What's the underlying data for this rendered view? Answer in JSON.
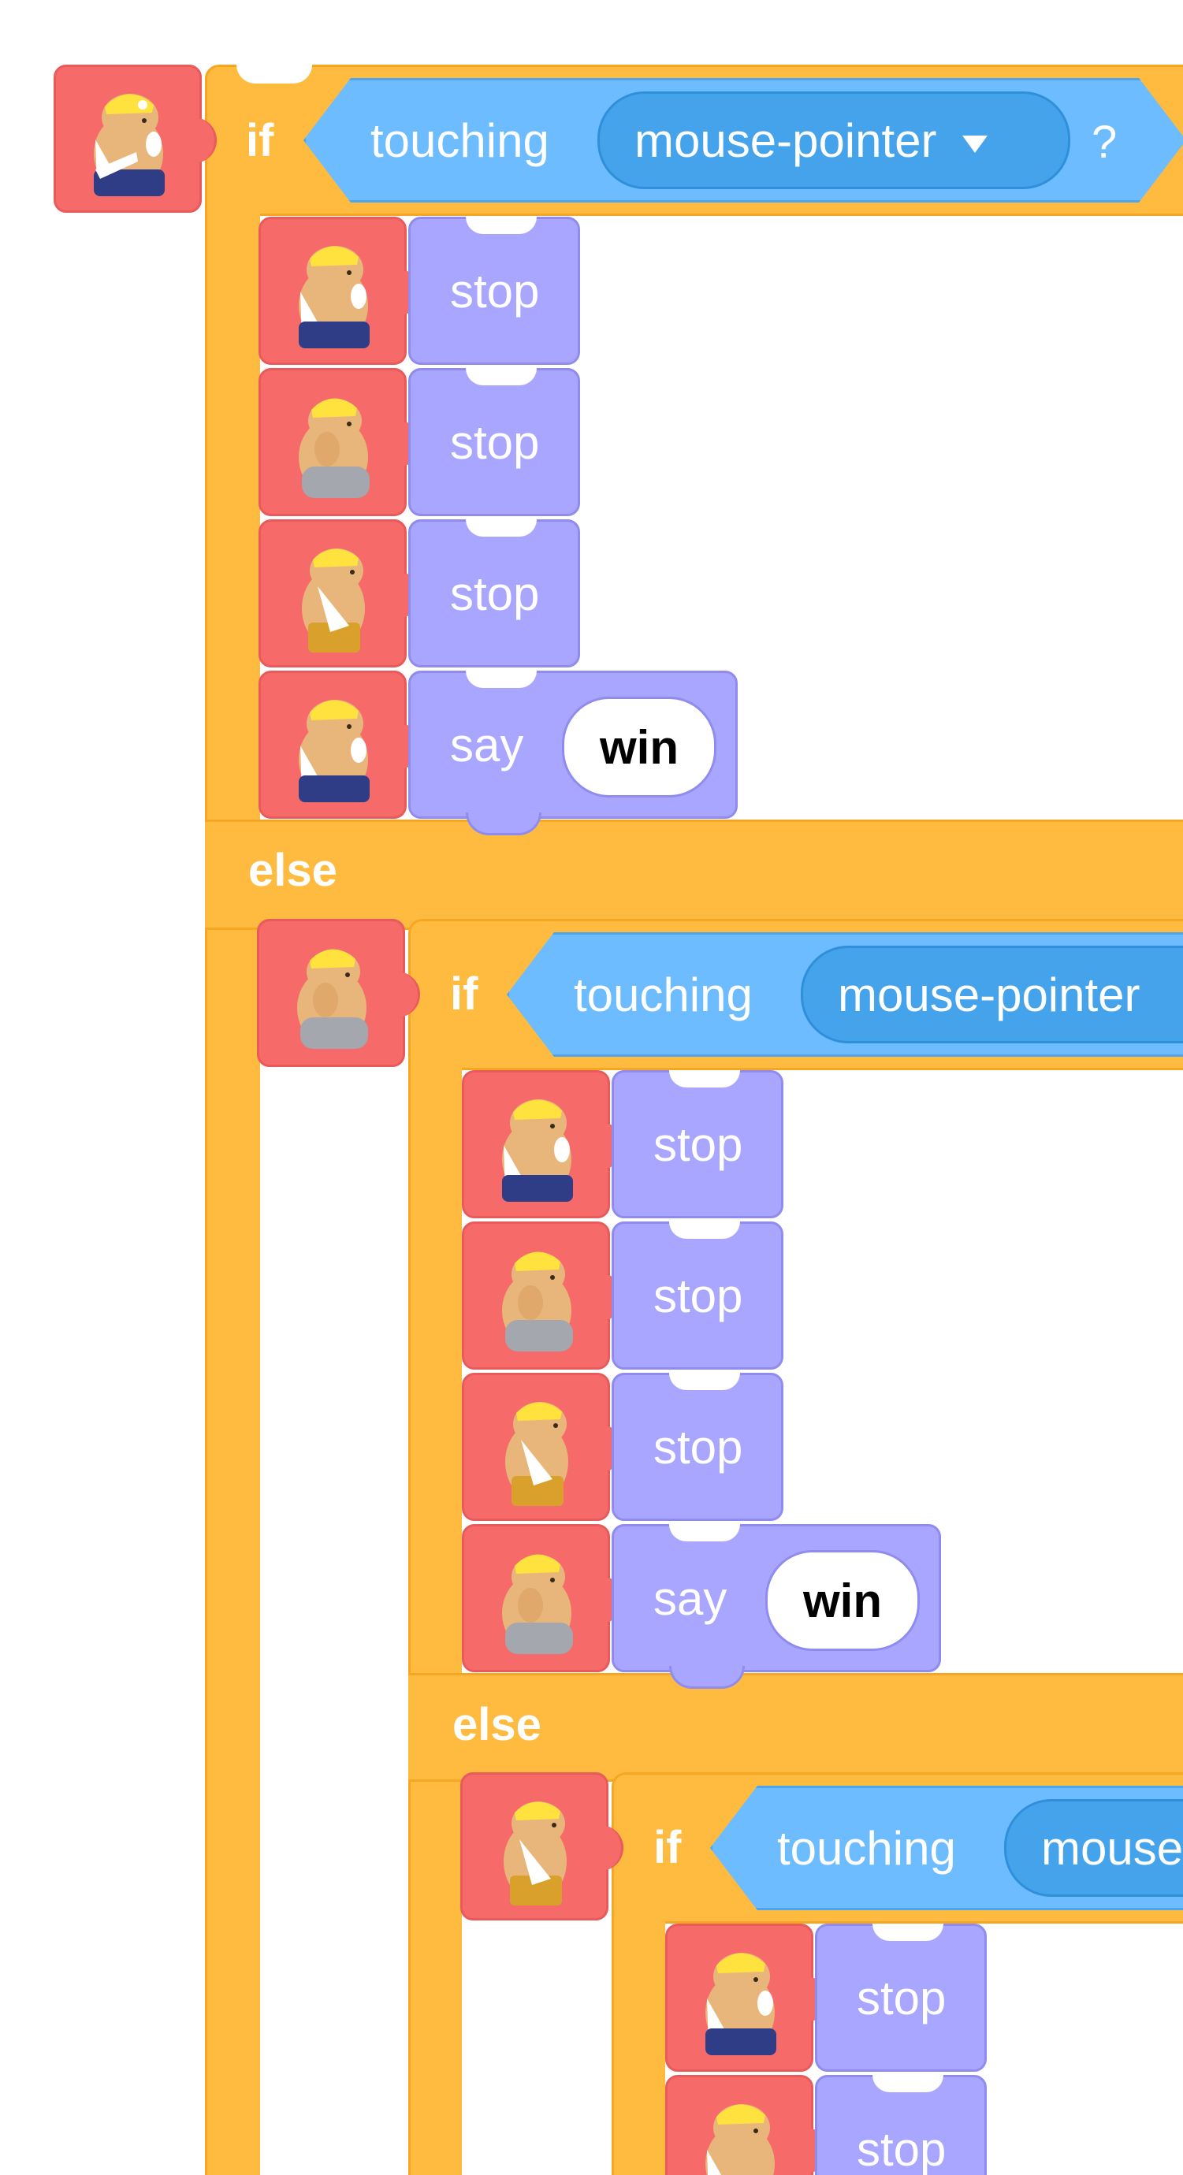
{
  "blocks": {
    "if_label": "if",
    "else_label": "else",
    "touching_label": "touching",
    "touching_target": "mouse-pointer",
    "question_mark": "?",
    "stop_label": "stop",
    "say_label": "say",
    "say_text": "win",
    "dropdown_icon": "triangle-down-icon"
  },
  "sprites": {
    "colors": {
      "navy": "#2e3d86",
      "gray": "#a4a7ad",
      "gold": "#d9a12c",
      "tile": "#f66a6a",
      "orange_block": "#ffbb40",
      "purple_block": "#a9a6ff",
      "sensing_block": "#6cbcff",
      "dropdown": "#45a3ec"
    }
  }
}
